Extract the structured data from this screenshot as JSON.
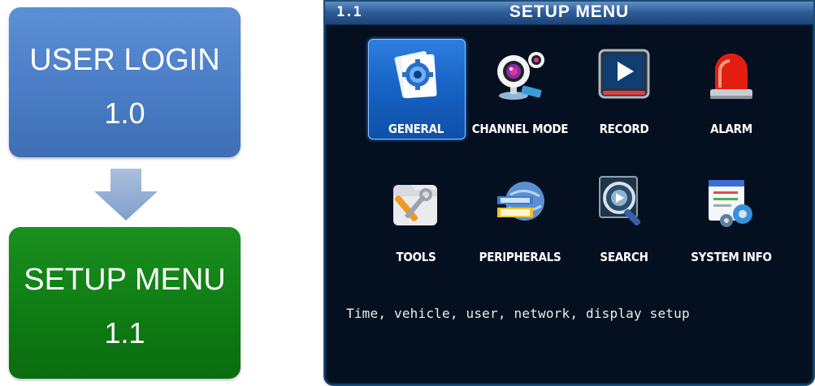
{
  "flow": {
    "login": {
      "title": "USER LOGIN",
      "num": "1.0"
    },
    "setup": {
      "title": "SETUP MENU",
      "num": "1.1"
    }
  },
  "screen": {
    "title_num": "1.1",
    "title": "SETUP MENU",
    "selected": "GENERAL",
    "items": [
      {
        "label": "GENERAL",
        "icon": "general-settings-icon"
      },
      {
        "label": "CHANNEL MODE",
        "icon": "webcam-icon"
      },
      {
        "label": "RECORD",
        "icon": "record-play-icon"
      },
      {
        "label": "ALARM",
        "icon": "alarm-siren-icon"
      },
      {
        "label": "TOOLS",
        "icon": "tools-icon"
      },
      {
        "label": "PERIPHERALS",
        "icon": "peripherals-globe-icon"
      },
      {
        "label": "SEARCH",
        "icon": "search-magnifier-icon"
      },
      {
        "label": "SYSTEM INFO",
        "icon": "system-info-icon"
      }
    ],
    "description": "Time, vehicle, user, network, display setup"
  },
  "colors": {
    "login_box": "#4a7dc5",
    "setup_box": "#0f7d14",
    "screen_bg": "#04101f",
    "selection": "#1764c6"
  }
}
